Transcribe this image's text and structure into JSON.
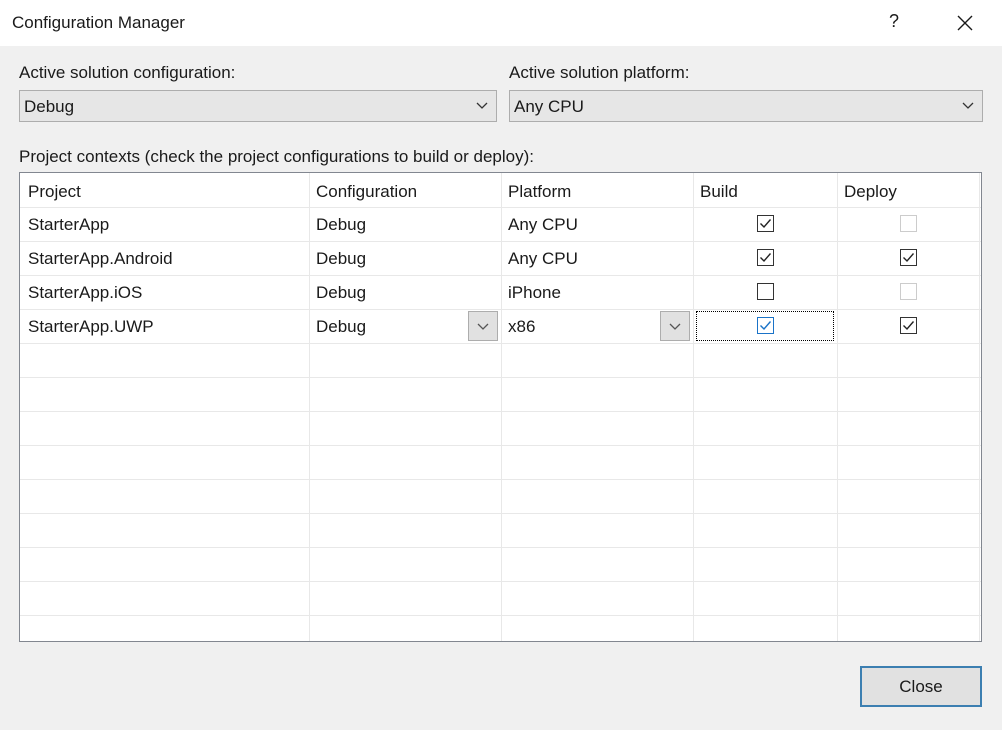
{
  "dialog": {
    "title": "Configuration Manager",
    "help_label": "?"
  },
  "active_config": {
    "label": "Active solution configuration:",
    "value": "Debug"
  },
  "active_platform": {
    "label": "Active solution platform:",
    "value": "Any CPU"
  },
  "contexts_label": "Project contexts (check the project configurations to build or deploy):",
  "table": {
    "headers": [
      "Project",
      "Configuration",
      "Platform",
      "Build",
      "Deploy"
    ],
    "rows": [
      {
        "project": "StarterApp",
        "configuration": "Debug",
        "platform": "Any CPU",
        "build": true,
        "deploy": false,
        "deploy_enabled": false
      },
      {
        "project": "StarterApp.Android",
        "configuration": "Debug",
        "platform": "Any CPU",
        "build": true,
        "deploy": true,
        "deploy_enabled": true
      },
      {
        "project": "StarterApp.iOS",
        "configuration": "Debug",
        "platform": "iPhone",
        "build": false,
        "deploy": false,
        "deploy_enabled": false
      },
      {
        "project": "StarterApp.UWP",
        "configuration": "Debug",
        "platform": "x86",
        "build": true,
        "deploy": true,
        "deploy_enabled": true
      }
    ]
  },
  "buttons": {
    "close_label": "Close"
  },
  "colors": {
    "accent": "#3c7fb1",
    "check_focused": "#1a73c8"
  }
}
